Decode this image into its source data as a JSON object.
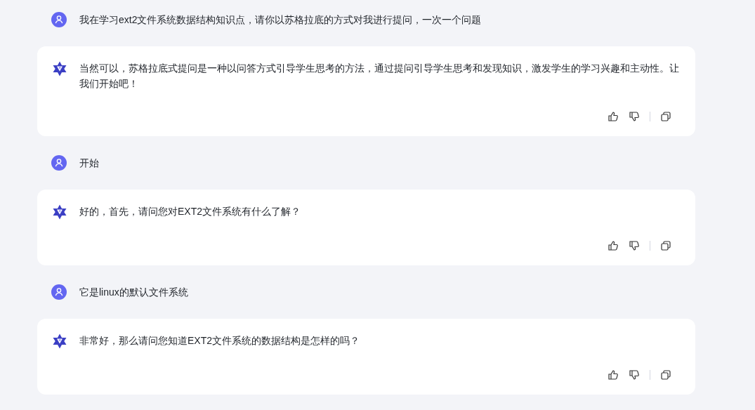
{
  "messages": [
    {
      "kind": "user",
      "text": "我在学习ext2文件系统数据结构知识点，请你以苏格拉底的方式对我进行提问，一次一个问题"
    },
    {
      "kind": "assistant",
      "text": "当然可以，苏格拉底式提问是一种以问答方式引导学生思考的方法，通过提问引导学生思考和发现知识，激发学生的学习兴趣和主动性。让我们开始吧！"
    },
    {
      "kind": "user",
      "text": "开始"
    },
    {
      "kind": "assistant",
      "text": "好的，首先，请问您对EXT2文件系统有什么了解？"
    },
    {
      "kind": "user",
      "text": "它是linux的默认文件系统"
    },
    {
      "kind": "assistant",
      "text": "非常好，那么请问您知道EXT2文件系统的数据结构是怎样的吗？"
    }
  ]
}
